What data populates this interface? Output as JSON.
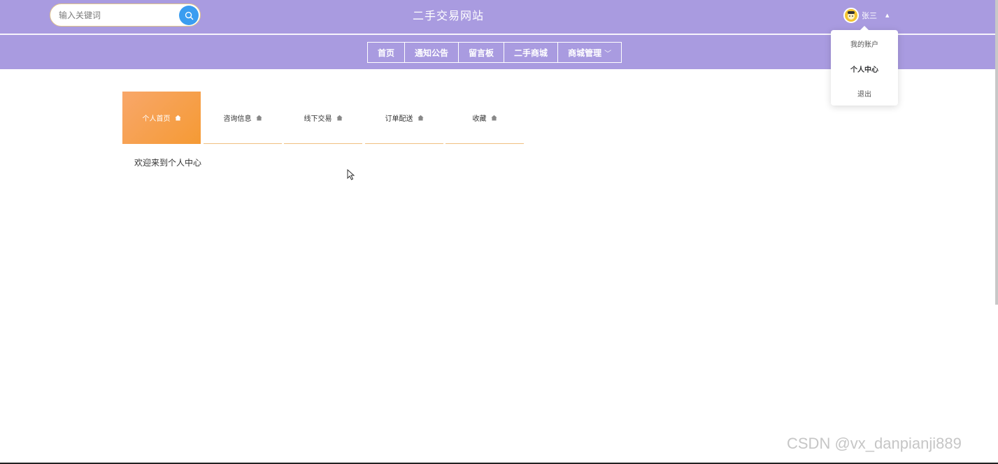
{
  "header": {
    "title": "二手交易网站",
    "search": {
      "placeholder": "输入关键词",
      "icon": "search-icon"
    },
    "user": {
      "name": "张三",
      "avatar_icon": "avatar-icon",
      "caret": "▲"
    },
    "dropdown": [
      {
        "label": "我的账户"
      },
      {
        "label": "个人中心"
      },
      {
        "label": "退出"
      }
    ]
  },
  "nav": {
    "items": [
      {
        "label": "首页"
      },
      {
        "label": "通知公告"
      },
      {
        "label": "留言板"
      },
      {
        "label": "二手商城"
      },
      {
        "label": "商城管理"
      }
    ],
    "chevron": "﹀"
  },
  "tabs": [
    {
      "label": "个人首页",
      "active": true
    },
    {
      "label": "咨询信息",
      "active": false
    },
    {
      "label": "线下交易",
      "active": false
    },
    {
      "label": "订单配送",
      "active": false
    },
    {
      "label": "收藏",
      "active": false
    }
  ],
  "main": {
    "welcome": "欢迎来到个人中心"
  },
  "watermark": "CSDN @vx_danpianji889",
  "colors": {
    "header": "#a99be0",
    "accent": "#f59a34",
    "search_button": "#3a9df0"
  }
}
